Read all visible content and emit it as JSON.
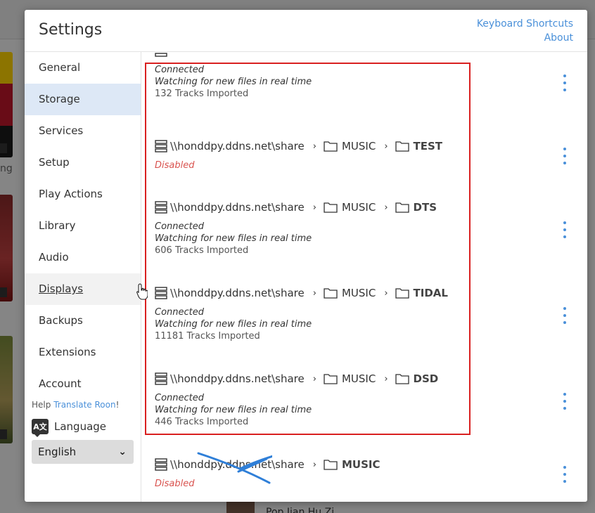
{
  "dialog": {
    "title": "Settings",
    "links": {
      "keyboard_shortcuts": "Keyboard Shortcuts",
      "about": "About"
    }
  },
  "sidebar": {
    "items": [
      {
        "label": "General"
      },
      {
        "label": "Storage",
        "active": true
      },
      {
        "label": "Services"
      },
      {
        "label": "Setup"
      },
      {
        "label": "Play Actions"
      },
      {
        "label": "Library"
      },
      {
        "label": "Audio"
      },
      {
        "label": "Displays",
        "hover": true
      },
      {
        "label": "Backups"
      },
      {
        "label": "Extensions"
      },
      {
        "label": "Account"
      }
    ],
    "help_prefix": "Help",
    "help_link": "Translate Roon",
    "help_suffix": "!",
    "language_label": "Language",
    "language_icon_text": "A文",
    "language_value": "English"
  },
  "storage": {
    "partial_entry": {
      "status": "Connected",
      "watching": "Watching for new files in real time",
      "tracks": "132 Tracks Imported"
    },
    "entries": [
      {
        "server": "\\\\honddpy.ddns.net\\share",
        "folders": [
          "MUSIC",
          "TEST"
        ],
        "status": "Disabled"
      },
      {
        "server": "\\\\honddpy.ddns.net\\share",
        "folders": [
          "MUSIC",
          "DTS"
        ],
        "status": "Connected",
        "watching": "Watching for new files in real time",
        "tracks": "606 Tracks Imported"
      },
      {
        "server": "\\\\honddpy.ddns.net\\share",
        "folders": [
          "MUSIC",
          "TIDAL"
        ],
        "status": "Connected",
        "watching": "Watching for new files in real time",
        "tracks": "11181 Tracks Imported"
      },
      {
        "server": "\\\\honddpy.ddns.net\\share",
        "folders": [
          "MUSIC",
          "DSD"
        ],
        "status": "Connected",
        "watching": "Watching for new files in real time",
        "tracks": "446 Tracks Imported"
      },
      {
        "server": "\\\\honddpy.ddns.net\\share",
        "folders": [
          "MUSIC"
        ],
        "status": "Disabled"
      }
    ]
  },
  "background": {
    "now_playing": "Pop Jian Hu Zi"
  },
  "colors": {
    "accent": "#4a90d9",
    "disabled": "#d9534f",
    "highlight": "#d92020",
    "cross": "#2f7fd8",
    "active_nav": "#dde8f6"
  }
}
